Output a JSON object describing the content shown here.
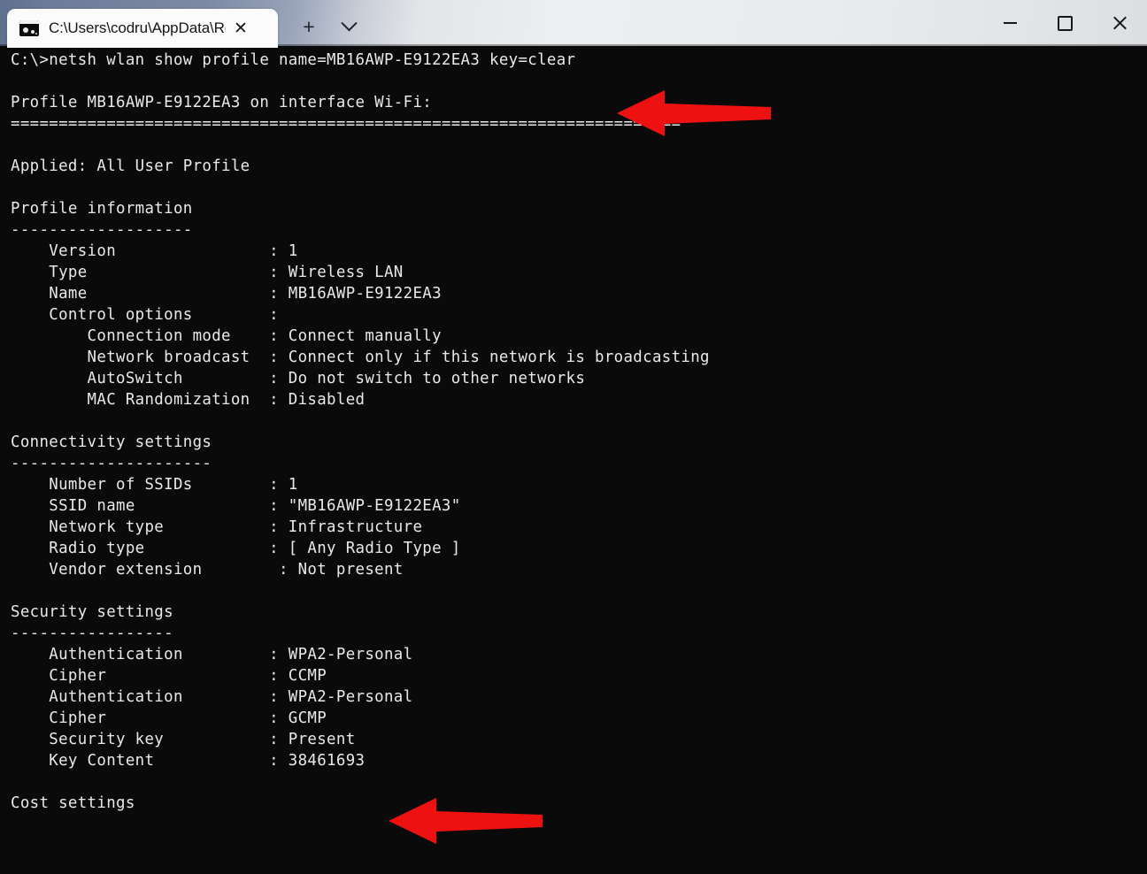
{
  "window": {
    "tab": {
      "title": "C:\\Users\\codru\\AppData\\Roa",
      "icon": "console-window-icon",
      "close_label": "✕"
    },
    "new_tab_label": "+",
    "dropdown_label": "⌄",
    "controls": {
      "minimize_label": "–",
      "maximize_label": "□",
      "close_label": "✕"
    }
  },
  "terminal": {
    "background_color": "#0a0a0a",
    "text_color": "#e9e9e9",
    "prompt": "C:\\>",
    "command": "netsh wlan show profile name=MB16AWP-E9122EA3 key=clear",
    "output": "C:\\>netsh wlan show profile name=MB16AWP-E9122EA3 key=clear\n\nProfile MB16AWP-E9122EA3 on interface Wi-Fi:\n======================================================================\n\nApplied: All User Profile\n\nProfile information\n-------------------\n    Version                : 1\n    Type                   : Wireless LAN\n    Name                   : MB16AWP-E9122EA3\n    Control options        :\n        Connection mode    : Connect manually\n        Network broadcast  : Connect only if this network is broadcasting\n        AutoSwitch         : Do not switch to other networks\n        MAC Randomization  : Disabled\n\nConnectivity settings\n---------------------\n    Number of SSIDs        : 1\n    SSID name              : \"MB16AWP-E9122EA3\"\n    Network type           : Infrastructure\n    Radio type             : [ Any Radio Type ]\n    Vendor extension        : Not present\n\nSecurity settings\n-----------------\n    Authentication         : WPA2-Personal\n    Cipher                 : CCMP\n    Authentication         : WPA2-Personal\n    Cipher                 : GCMP\n    Security key           : Present\n    Key Content            : 38461693\n\nCost settings",
    "fields": {
      "profile_header": "Profile MB16AWP-E9122EA3 on interface Wi-Fi:",
      "applied": "Applied: All User Profile",
      "sections": [
        {
          "title": "Profile information",
          "rows": [
            {
              "label": "Version",
              "value": "1"
            },
            {
              "label": "Type",
              "value": "Wireless LAN"
            },
            {
              "label": "Name",
              "value": "MB16AWP-E9122EA3"
            },
            {
              "label": "Control options",
              "value": ""
            },
            {
              "label": "Connection mode",
              "value": "Connect manually"
            },
            {
              "label": "Network broadcast",
              "value": "Connect only if this network is broadcasting"
            },
            {
              "label": "AutoSwitch",
              "value": "Do not switch to other networks"
            },
            {
              "label": "MAC Randomization",
              "value": "Disabled"
            }
          ]
        },
        {
          "title": "Connectivity settings",
          "rows": [
            {
              "label": "Number of SSIDs",
              "value": "1"
            },
            {
              "label": "SSID name",
              "value": "\"MB16AWP-E9122EA3\""
            },
            {
              "label": "Network type",
              "value": "Infrastructure"
            },
            {
              "label": "Radio type",
              "value": "[ Any Radio Type ]"
            },
            {
              "label": "Vendor extension",
              "value": "Not present"
            }
          ]
        },
        {
          "title": "Security settings",
          "rows": [
            {
              "label": "Authentication",
              "value": "WPA2-Personal"
            },
            {
              "label": "Cipher",
              "value": "CCMP"
            },
            {
              "label": "Authentication",
              "value": "WPA2-Personal"
            },
            {
              "label": "Cipher",
              "value": "GCMP"
            },
            {
              "label": "Security key",
              "value": "Present"
            },
            {
              "label": "Key Content",
              "value": "38461693"
            }
          ]
        },
        {
          "title": "Cost settings",
          "rows": []
        }
      ]
    }
  },
  "annotations": {
    "color": "#ee1111",
    "arrows": [
      {
        "name": "arrow-command-line",
        "points_to": "netsh wlan show profile command"
      },
      {
        "name": "arrow-key-content",
        "points_to": "Key Content : 38461693"
      }
    ]
  }
}
